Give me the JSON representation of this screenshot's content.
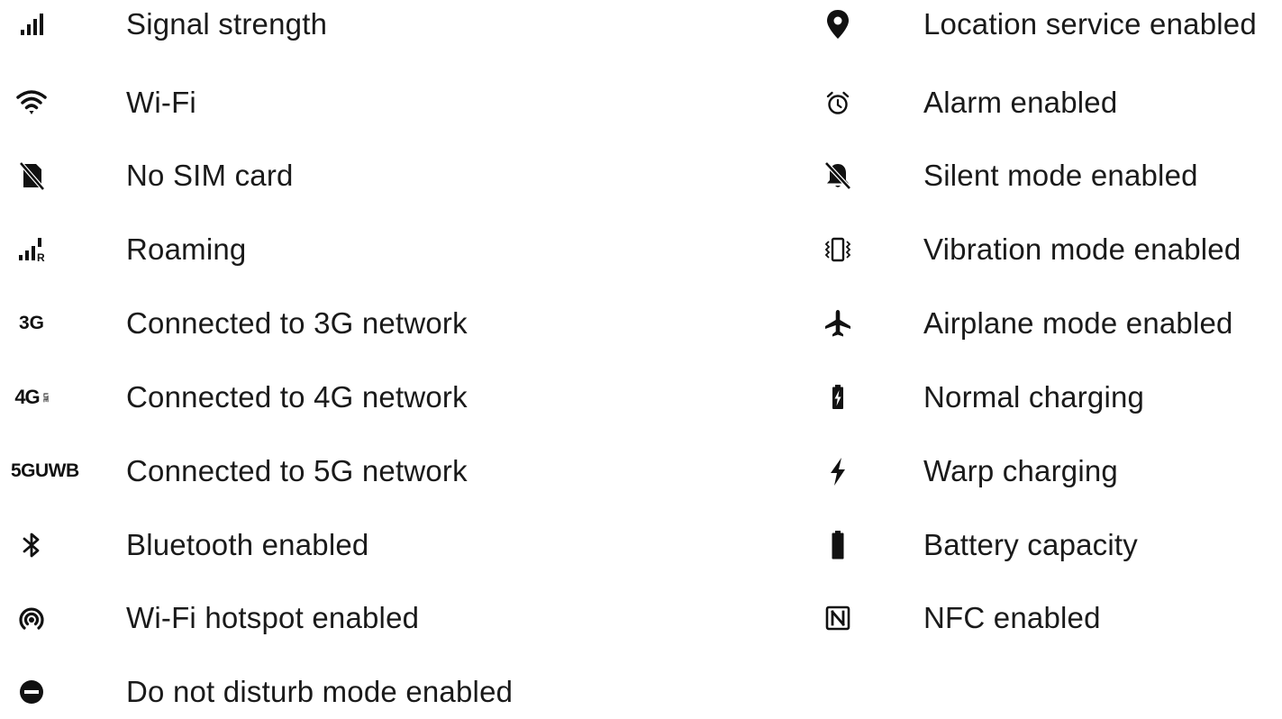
{
  "left_items": [
    {
      "icon": "signal-strength-icon",
      "label": "Signal strength"
    },
    {
      "icon": "wifi-icon",
      "label": "Wi-Fi"
    },
    {
      "icon": "no-sim-card-icon",
      "label": "No SIM card"
    },
    {
      "icon": "roaming-icon",
      "label": "Roaming",
      "icon_text": "R"
    },
    {
      "icon": "network-3g-icon",
      "label": "Connected to 3G network",
      "icon_text": "3G"
    },
    {
      "icon": "network-4g-lte-icon",
      "label": "Connected to 4G network",
      "icon_text": "4G",
      "icon_subtext": "LTE"
    },
    {
      "icon": "network-5g-uwb-icon",
      "label": "Connected to 5G network",
      "icon_text": "5GUWB"
    },
    {
      "icon": "bluetooth-icon",
      "label": "Bluetooth enabled"
    },
    {
      "icon": "wifi-hotspot-icon",
      "label": "Wi-Fi hotspot enabled"
    },
    {
      "icon": "do-not-disturb-icon",
      "label": "Do not disturb mode enabled"
    }
  ],
  "right_items": [
    {
      "icon": "location-pin-icon",
      "label": "Location service enabled"
    },
    {
      "icon": "alarm-clock-icon",
      "label": "Alarm enabled"
    },
    {
      "icon": "silent-bell-off-icon",
      "label": "Silent mode enabled"
    },
    {
      "icon": "vibration-icon",
      "label": "Vibration mode enabled"
    },
    {
      "icon": "airplane-icon",
      "label": "Airplane mode enabled"
    },
    {
      "icon": "battery-charging-icon",
      "label": "Normal charging"
    },
    {
      "icon": "lightning-bolt-icon",
      "label": "Warp charging"
    },
    {
      "icon": "battery-full-icon",
      "label": "Battery capacity"
    },
    {
      "icon": "nfc-icon",
      "label": "NFC enabled"
    }
  ],
  "colors": {
    "icon": "#111111",
    "text": "#1a1a1a",
    "background": "#ffffff"
  }
}
